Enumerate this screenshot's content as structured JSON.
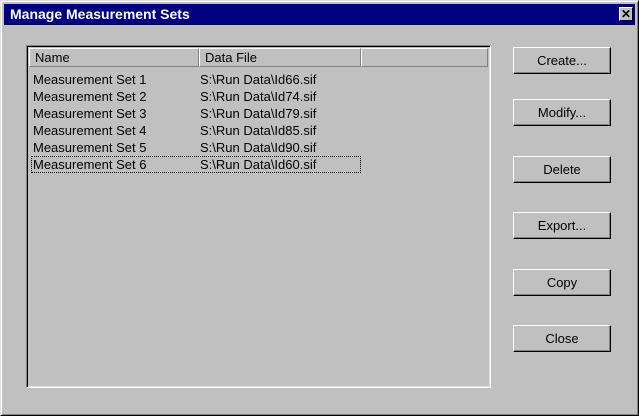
{
  "window": {
    "title": "Manage Measurement Sets",
    "close_glyph": "✕"
  },
  "list": {
    "columns": [
      "Name",
      "Data File",
      ""
    ],
    "rows": [
      {
        "name": "Measurement Set 1",
        "file": "S:\\Run Data\\Id66.sif"
      },
      {
        "name": "Measurement Set 2",
        "file": "S:\\Run Data\\Id74.sif"
      },
      {
        "name": "Measurement Set 3",
        "file": "S:\\Run Data\\Id79.sif"
      },
      {
        "name": "Measurement Set 4",
        "file": "S:\\Run Data\\Id85.sif"
      },
      {
        "name": "Measurement Set 5",
        "file": "S:\\Run Data\\Id90.sif"
      },
      {
        "name": "Measurement Set 6",
        "file": "S:\\Run Data\\Id60.sif"
      }
    ],
    "focused_row": 6
  },
  "buttons": {
    "create": "Create...",
    "modify": "Modify...",
    "delete": "Delete",
    "export": "Export...",
    "copy": "Copy",
    "close": "Close"
  },
  "colors": {
    "titlebar": "#000080",
    "face": "#c0c0c0"
  },
  "icons": {
    "close": "close-icon"
  }
}
